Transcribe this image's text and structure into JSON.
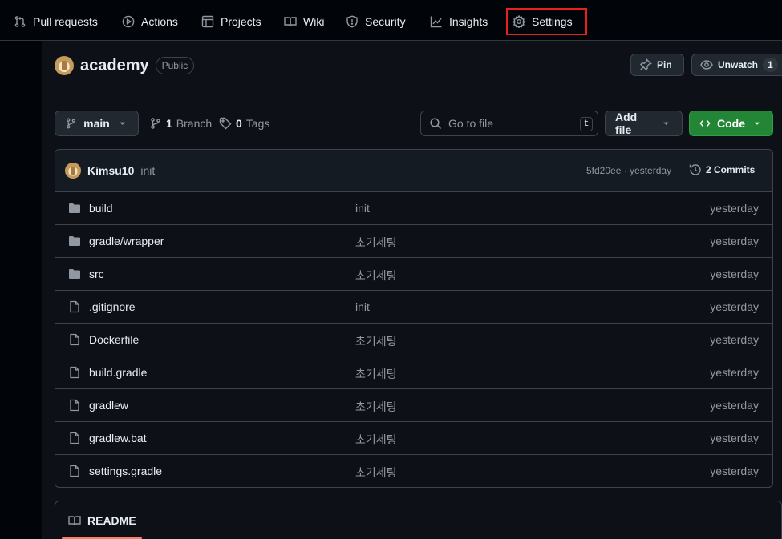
{
  "nav": {
    "items": [
      {
        "label": "Pull requests",
        "icon": "pull-request-icon"
      },
      {
        "label": "Actions",
        "icon": "play-icon"
      },
      {
        "label": "Projects",
        "icon": "table-icon"
      },
      {
        "label": "Wiki",
        "icon": "book-icon"
      },
      {
        "label": "Security",
        "icon": "shield-icon"
      },
      {
        "label": "Insights",
        "icon": "graph-icon"
      },
      {
        "label": "Settings",
        "icon": "gear-icon",
        "highlighted": true
      }
    ],
    "highlight_color": "#e5221c"
  },
  "repo": {
    "name": "academy",
    "visibility": "Public",
    "pin_label": "Pin",
    "watch_label": "Unwatch",
    "watch_count": "1"
  },
  "toolbar": {
    "branch": "main",
    "branch_count": "1",
    "branch_label": "Branch",
    "tag_count": "0",
    "tag_label": "Tags",
    "search_placeholder": "Go to file",
    "search_shortcut": "t",
    "add_file_label": "Add file",
    "code_label": "Code",
    "code_color": "#238636"
  },
  "latest_commit": {
    "author": "Kimsu10",
    "message": "init",
    "hash_time": "5fd20ee · yesterday",
    "commits_label": "2 Commits"
  },
  "files": [
    {
      "name": "build",
      "type": "folder",
      "message": "init",
      "date": "yesterday"
    },
    {
      "name": "gradle/wrapper",
      "type": "folder",
      "message": "초기세팅",
      "date": "yesterday"
    },
    {
      "name": "src",
      "type": "folder",
      "message": "초기세팅",
      "date": "yesterday"
    },
    {
      "name": ".gitignore",
      "type": "file",
      "message": "init",
      "date": "yesterday"
    },
    {
      "name": "Dockerfile",
      "type": "file",
      "message": "초기세팅",
      "date": "yesterday"
    },
    {
      "name": "build.gradle",
      "type": "file",
      "message": "초기세팅",
      "date": "yesterday"
    },
    {
      "name": "gradlew",
      "type": "file",
      "message": "초기세팅",
      "date": "yesterday"
    },
    {
      "name": "gradlew.bat",
      "type": "file",
      "message": "초기세팅",
      "date": "yesterday"
    },
    {
      "name": "settings.gradle",
      "type": "file",
      "message": "초기세팅",
      "date": "yesterday"
    }
  ],
  "readme": {
    "label": "README"
  }
}
